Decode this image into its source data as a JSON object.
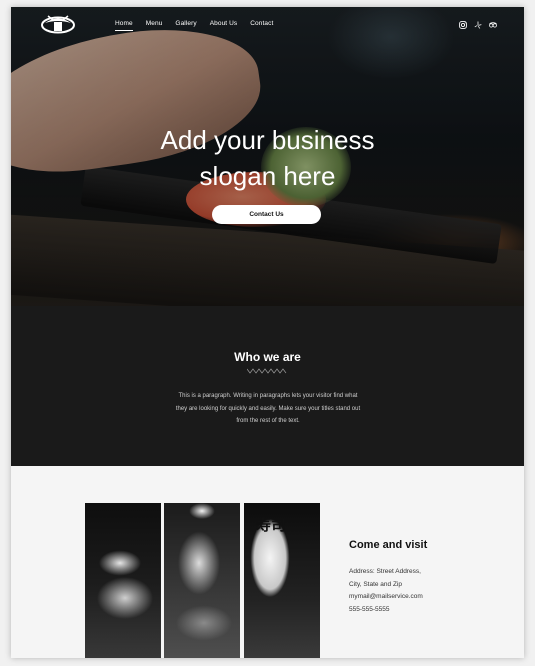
{
  "nav": {
    "items": [
      {
        "label": "Home",
        "active": true
      },
      {
        "label": "Menu"
      },
      {
        "label": "Gallery"
      },
      {
        "label": "About Us"
      },
      {
        "label": "Contact"
      }
    ],
    "social_icons": [
      "instagram-icon",
      "yelp-icon",
      "tripadvisor-icon"
    ]
  },
  "hero": {
    "slogan_line1": "Add your business",
    "slogan_line2": "slogan here",
    "cta_label": "Contact Us"
  },
  "about": {
    "heading": "Who we are",
    "paragraph": "This is a paragraph. Writing in paragraphs lets your visitor find what they are looking for quickly and easily. Make sure your titles stand out from the rest of the text."
  },
  "visit": {
    "heading": "Come and visit",
    "address_line1": "Address: Street Address,",
    "address_line2": "City, State and Zip",
    "email": "mymail@mailservice.com",
    "phone": "555-555-5555",
    "lantern_text": "寿司"
  },
  "colors": {
    "hero_overlay": "#151515",
    "dark_section": "#1a1a1a",
    "light_section": "#f5f5f5",
    "accent": "#ffffff"
  }
}
